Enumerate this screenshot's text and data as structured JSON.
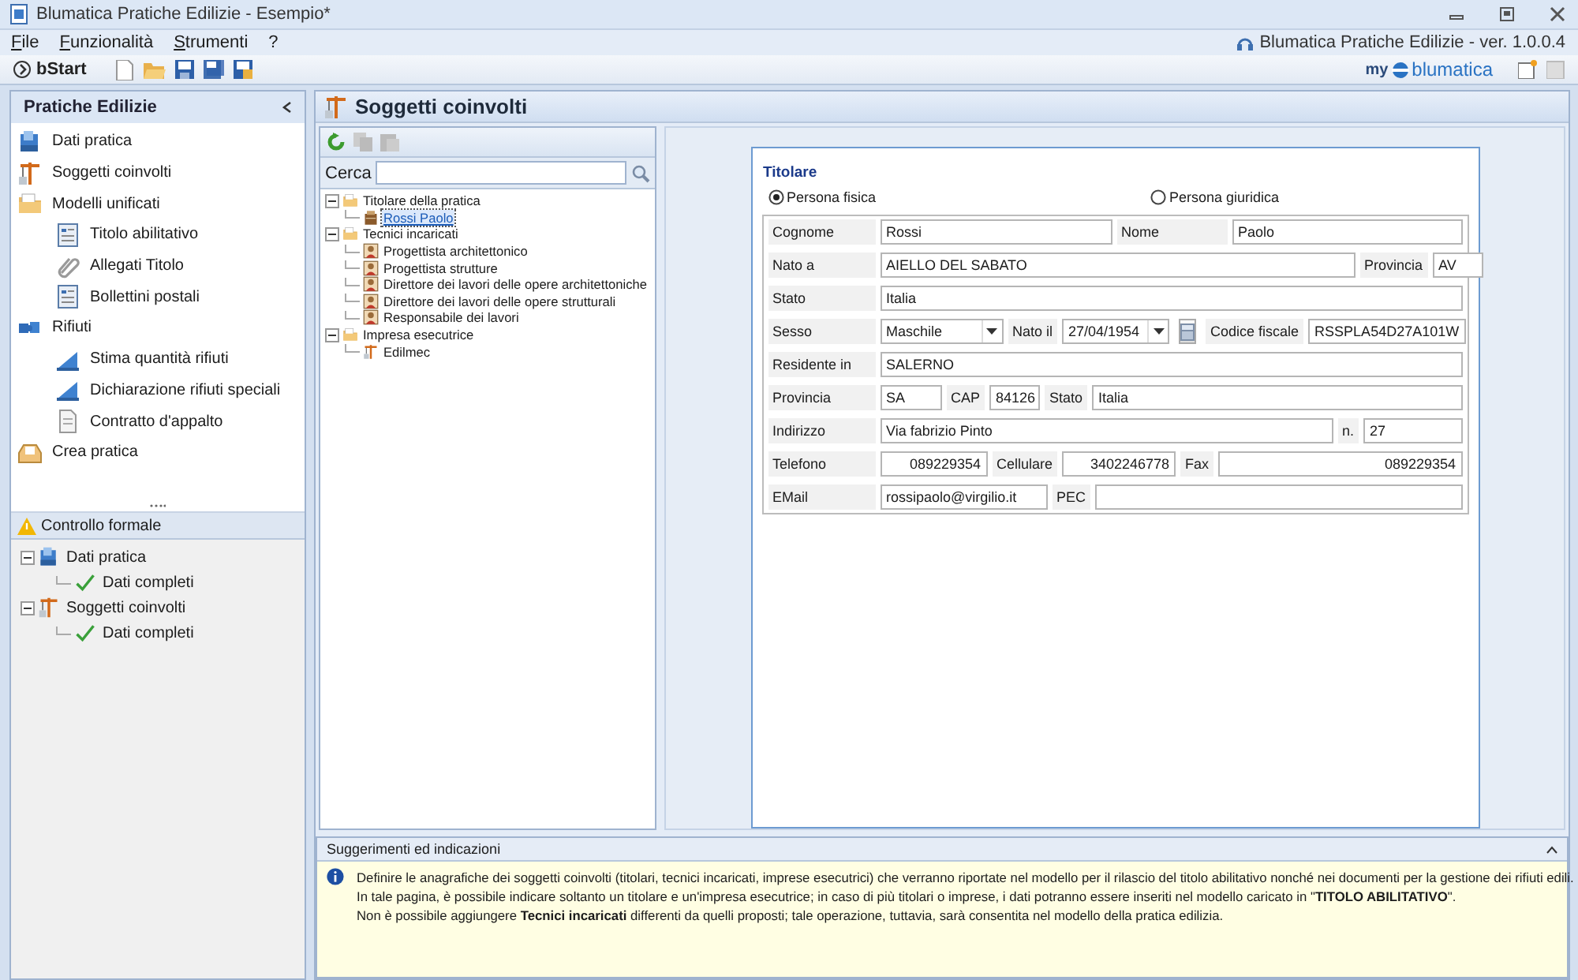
{
  "window": {
    "title": "Blumatica Pratiche Edilizie - Esempio*"
  },
  "menu": [
    "File",
    "Funzionalità",
    "Strumenti",
    "?"
  ],
  "version_label": "Blumatica Pratiche Edilizie - ver. 1.0.0.4",
  "toolbar": {
    "start_label": "bStart",
    "brand": {
      "prefix": "my",
      "name": "blumatica"
    }
  },
  "nav": {
    "title": "Pratiche Edilizie",
    "items": [
      {
        "label": "Dati pratica",
        "kind": "doc"
      },
      {
        "label": "Soggetti coinvolti",
        "kind": "crane"
      },
      {
        "label": "Modelli unificati",
        "kind": "folder",
        "children": [
          {
            "label": "Titolo abilitativo",
            "kind": "form"
          },
          {
            "label": "Allegati Titolo",
            "kind": "clip"
          },
          {
            "label": "Bollettini postali",
            "kind": "form"
          }
        ]
      },
      {
        "label": "Rifiuti",
        "kind": "puzzle",
        "children": [
          {
            "label": "Stima quantità rifiuti",
            "kind": "chart"
          },
          {
            "label": "Dichiarazione rifiuti speciali",
            "kind": "chart"
          },
          {
            "label": "Contratto d'appalto",
            "kind": "page"
          }
        ]
      },
      {
        "label": "Crea pratica",
        "kind": "box"
      }
    ]
  },
  "check_panel": {
    "title": "Controllo formale",
    "items": [
      {
        "label": "Dati pratica",
        "kind": "doc",
        "children": [
          {
            "label": "Dati completi",
            "kind": "check"
          }
        ]
      },
      {
        "label": "Soggetti coinvolti",
        "kind": "crane",
        "children": [
          {
            "label": "Dati completi",
            "kind": "check"
          }
        ]
      }
    ]
  },
  "page_title": "Soggetti coinvolti",
  "search": {
    "label": "Cerca"
  },
  "tree": [
    {
      "label": "Titolare della pratica",
      "kind": "folder",
      "selected": false,
      "children": [
        {
          "label": "Rossi Paolo",
          "kind": "person2",
          "selected": true
        }
      ]
    },
    {
      "label": "Tecnici incaricati",
      "kind": "folder",
      "selected": false,
      "children": [
        {
          "label": "Progettista architettonico",
          "kind": "person",
          "selected": false
        },
        {
          "label": "Progettista strutture",
          "kind": "person",
          "selected": false
        },
        {
          "label": "Direttore dei lavori delle opere architettoniche",
          "kind": "person",
          "selected": false
        },
        {
          "label": "Direttore dei lavori delle opere strutturali",
          "kind": "person",
          "selected": false
        },
        {
          "label": "Responsabile dei lavori",
          "kind": "person",
          "selected": false
        }
      ]
    },
    {
      "label": "Impresa esecutrice",
      "kind": "folder",
      "selected": false,
      "children": [
        {
          "label": "Edilmec",
          "kind": "crane",
          "selected": false
        }
      ]
    }
  ],
  "form": {
    "title": "Titolare",
    "person_types": [
      {
        "label": "Persona fisica",
        "selected": true
      },
      {
        "label": "Persona giuridica",
        "selected": false
      }
    ],
    "rows": [
      {
        "fields": [
          {
            "label": "Cognome",
            "value": "Rossi",
            "kind": "text"
          },
          {
            "label": "Nome",
            "value": "Paolo",
            "kind": "text"
          }
        ]
      },
      {
        "fields": [
          {
            "label": "Nato a",
            "value": "AIELLO DEL SABATO",
            "kind": "text"
          },
          {
            "label": "Provincia",
            "value": "AV",
            "kind": "text"
          }
        ]
      },
      {
        "fields": [
          {
            "label": "Stato",
            "value": "Italia",
            "kind": "text"
          }
        ]
      },
      {
        "fields": [
          {
            "label": "Sesso",
            "value": "Maschile",
            "kind": "combo"
          },
          {
            "label": "Nato il",
            "value": "27/04/1954",
            "kind": "combo"
          },
          {
            "kind": "calendar"
          },
          {
            "label": "Codice fiscale",
            "value": "RSSPLA54D27A101W",
            "kind": "text"
          }
        ]
      },
      {
        "fields": [
          {
            "label": "Residente in",
            "value": "SALERNO",
            "kind": "text"
          }
        ]
      },
      {
        "fields": [
          {
            "label": "Provincia",
            "value": "SA",
            "kind": "text"
          },
          {
            "label": "CAP",
            "value": "84126",
            "kind": "text"
          },
          {
            "label": "Stato",
            "value": "Italia",
            "kind": "text"
          }
        ]
      },
      {
        "fields": [
          {
            "label": "Indirizzo",
            "value": "Via fabrizio Pinto",
            "kind": "text"
          },
          {
            "label": "n.",
            "value": "27",
            "kind": "text"
          }
        ]
      },
      {
        "fields": [
          {
            "label": "Telefono",
            "value": "089229354",
            "kind": "number"
          },
          {
            "label": "Cellulare",
            "value": "3402246778",
            "kind": "number"
          },
          {
            "label": "Fax",
            "value": "089229354",
            "kind": "number"
          }
        ]
      },
      {
        "fields": [
          {
            "label": "EMail",
            "value": "rossipaolo@virgilio.it",
            "kind": "text"
          },
          {
            "label": "PEC",
            "kind": "text"
          }
        ]
      }
    ]
  },
  "hints": {
    "title": "Suggerimenti ed indicazioni",
    "lines": [
      "Definire le anagrafiche dei soggetti coinvolti (titolari, tecnici incaricati, imprese esecutrici) che verranno riportate nel modello per il rilascio del titolo abilitativo nonché nei documenti per la gestione dei rifiuti edili.",
      "In tale pagina, è possibile indicare soltanto un titolare e un'impresa esecutrice; in caso di più titolari o imprese, i dati potranno essere inseriti nel modello caricato in \"**TITOLO ABILITATIVO**\".",
      "Non è possibile aggiungere **Tecnici incaricati** differenti da quelli proposti;  tale operazione, tuttavia, sarà consentita nel modello della pratica edilizia."
    ]
  }
}
